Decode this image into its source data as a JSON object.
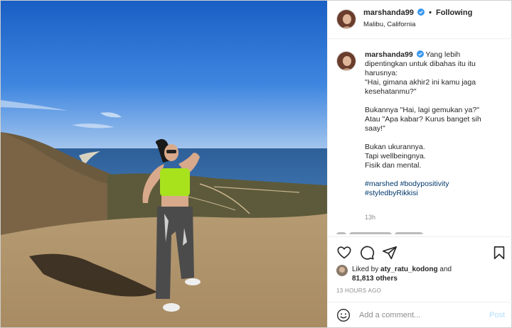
{
  "post": {
    "username": "marshanda99",
    "follow_separator": "•",
    "follow_label": "Following",
    "location": "Malibu, California"
  },
  "caption": {
    "username": "marshanda99",
    "para1": "Yang lebih dipentingkan untuk dibahas itu itu harusnya:",
    "para2": "\"Hai, gimana akhir2 ini kamu jaga kesehatanmu?\"",
    "para3": "Bukannya \"Hai, lagi gemukan ya?\"",
    "para4": "Atau \"Apa kabar? Kurus banget sih saay!\"",
    "para5": "Bukan ukurannya.",
    "para6": "Tapi wellbeingnya.",
    "para7": "Fisik dan mental.",
    "hashtag1": "#marshed",
    "hashtag2": "#bodypositivity",
    "hashtag3": "#styledbyRikkisi",
    "time": "13h"
  },
  "likes": {
    "prefix": "Liked by",
    "user": "aty_ratu_kodong",
    "and": "and",
    "count": "81,813 others"
  },
  "timestamp": "13 HOURS AGO",
  "comment": {
    "placeholder": "Add a comment...",
    "post_label": "Post"
  },
  "icons": {
    "like": "heart-icon",
    "comment": "comment-icon",
    "share": "share-icon",
    "save": "bookmark-icon",
    "emoji": "emoji-icon",
    "verified": "verified-badge-icon"
  },
  "colors": {
    "verified": "#3897f0",
    "hashtag": "#00376b",
    "post_button": "#b2dffc"
  }
}
